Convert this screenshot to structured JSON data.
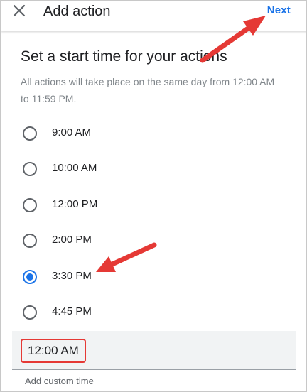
{
  "appbar": {
    "title": "Add action",
    "next_label": "Next",
    "close_icon": "close-icon"
  },
  "content": {
    "heading": "Set a start time for your actions",
    "subtext": "All actions will take place on the same day from 12:00 AM to 11:59 PM."
  },
  "options": [
    {
      "label": "9:00 AM",
      "selected": false
    },
    {
      "label": "10:00 AM",
      "selected": false
    },
    {
      "label": "12:00 PM",
      "selected": false
    },
    {
      "label": "2:00 PM",
      "selected": false
    },
    {
      "label": "3:30 PM",
      "selected": true
    },
    {
      "label": "4:45 PM",
      "selected": false
    }
  ],
  "custom": {
    "value": "12:00 AM",
    "helper": "Add custom time"
  },
  "colors": {
    "accent": "#1a73e8",
    "annotation": "#e53935"
  }
}
